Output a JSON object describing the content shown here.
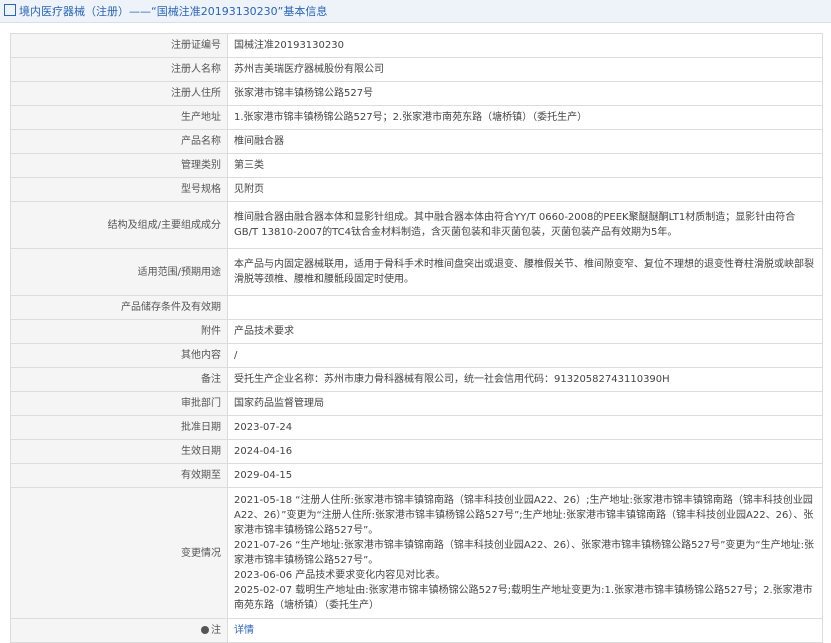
{
  "header": {
    "title": "境内医疗器械（注册）——“国械注准20193130230”基本信息"
  },
  "rows": [
    {
      "label": "注册证编号",
      "value": "国械注准20193130230"
    },
    {
      "label": "注册人名称",
      "value": "苏州吉美瑞医疗器械股份有限公司"
    },
    {
      "label": "注册人住所",
      "value": "张家港市锦丰镇杨锦公路527号"
    },
    {
      "label": "生产地址",
      "value": "1.张家港市锦丰镇杨锦公路527号；2.张家港市南苑东路（塘桥镇）（委托生产）"
    },
    {
      "label": "产品名称",
      "value": "椎间融合器"
    },
    {
      "label": "管理类别",
      "value": "第三类"
    },
    {
      "label": "型号规格",
      "value": "见附页"
    },
    {
      "label": "结构及组成/主要组成成分",
      "value": "椎间融合器由融合器本体和显影针组成。其中融合器本体由符合YY/T 0660-2008的PEEK聚醚醚酮LT1材质制造；显影针由符合GB/T 13810-2007的TC4钛合金材料制造，含灭菌包装和非灭菌包装，灭菌包装产品有效期为5年。"
    },
    {
      "label": "适用范围/预期用途",
      "value": "本产品与内固定器械联用，适用于骨科手术时椎间盘突出或退变、腰椎假关节、椎间隙变窄、复位不理想的退变性脊柱滑脱或峡部裂滑脱等颈椎、腰椎和腰骶段固定时使用。"
    },
    {
      "label": "产品储存条件及有效期",
      "value": ""
    },
    {
      "label": "附件",
      "value": "产品技术要求"
    },
    {
      "label": "其他内容",
      "value": "/"
    },
    {
      "label": "备注",
      "value": "受托生产企业名称：苏州市康力骨科器械有限公司，统一社会信用代码：91320582743110390H"
    },
    {
      "label": "审批部门",
      "value": "国家药品监督管理局"
    },
    {
      "label": "批准日期",
      "value": "2023-07-24"
    },
    {
      "label": "生效日期",
      "value": "2024-04-16"
    },
    {
      "label": "有效期至",
      "value": "2029-04-15"
    }
  ],
  "changes": {
    "label": "变更情况",
    "lines": [
      "2021-05-18 “注册人住所:张家港市锦丰镇锦南路（锦丰科技创业园A22、26）;生产地址:张家港市锦丰镇锦南路（锦丰科技创业园A22、26）”变更为“注册人住所:张家港市锦丰镇杨锦公路527号”;生产地址:张家港市锦丰镇锦南路（锦丰科技创业园A22、26）、张家港市锦丰镇杨锦公路527号”。",
      "2021-07-26 “生产地址:张家港市锦丰镇锦南路（锦丰科技创业园A22、26）、张家港市锦丰镇杨锦公路527号”变更为“生产地址:张家港市锦丰镇杨锦公路527号”。",
      "2023-06-06 产品技术要求变化内容见对比表。",
      "2025-02-07 载明生产地址由:张家港市锦丰镇杨锦公路527号;载明生产地址变更为:1.张家港市锦丰镇杨锦公路527号；2.张家港市南苑东路（塘桥镇）（委托生产）"
    ]
  },
  "footer": {
    "note_label": "注",
    "link_label": "详情"
  }
}
